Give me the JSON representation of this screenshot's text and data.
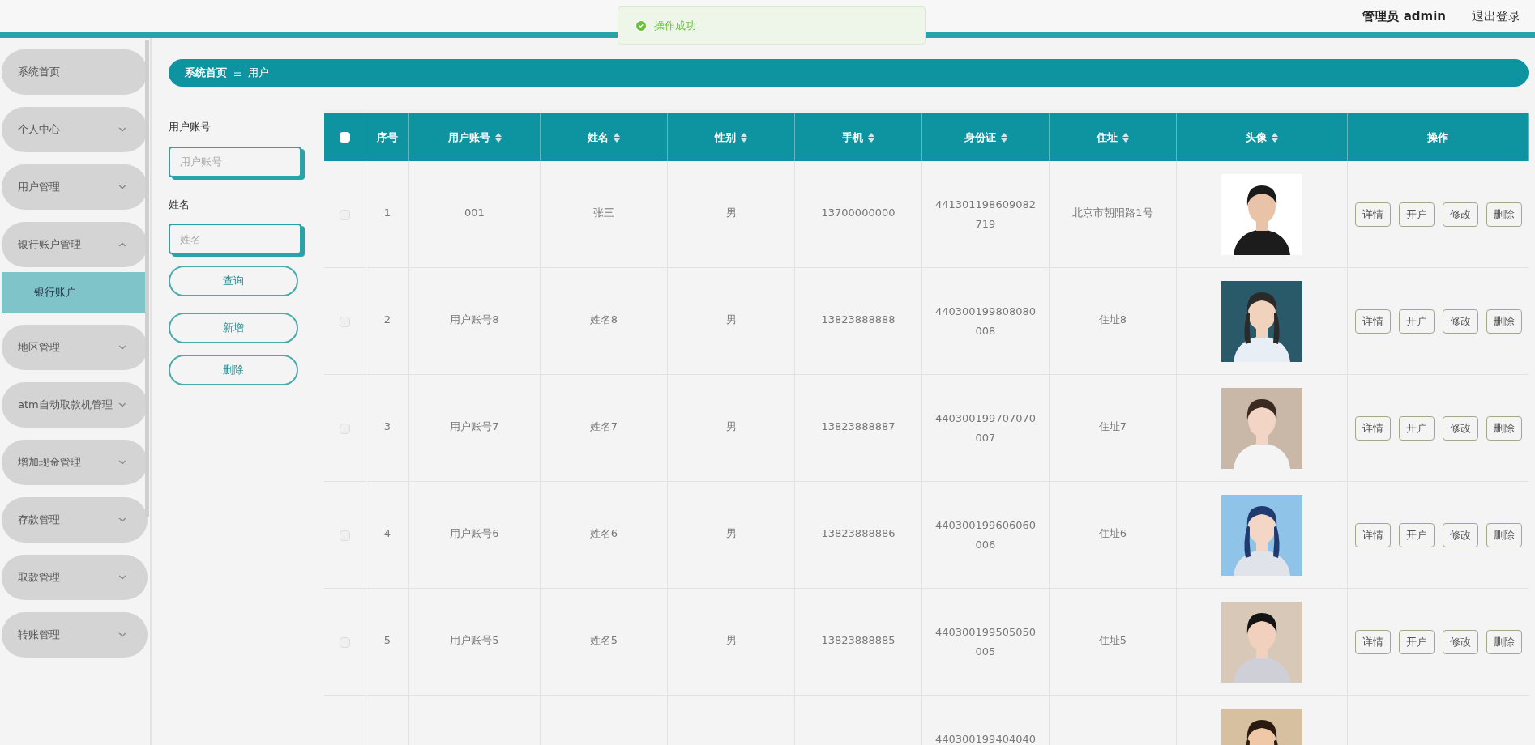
{
  "header": {
    "user_label": "管理员 admin",
    "logout": "退出登录"
  },
  "toast": {
    "text": "操作成功",
    "kind": "success"
  },
  "sidebar": {
    "items": [
      {
        "label": "系统首页",
        "kind": "link"
      },
      {
        "label": "个人中心",
        "kind": "menu",
        "expanded": false
      },
      {
        "label": "用户管理",
        "kind": "menu",
        "expanded": false
      },
      {
        "label": "银行账户管理",
        "kind": "menu",
        "expanded": true,
        "children": [
          {
            "label": "银行账户",
            "selected": true
          }
        ]
      },
      {
        "label": "地区管理",
        "kind": "menu",
        "expanded": false
      },
      {
        "label": "atm自动取款机管理",
        "kind": "menu",
        "expanded": false
      },
      {
        "label": "增加现金管理",
        "kind": "menu",
        "expanded": false
      },
      {
        "label": "存款管理",
        "kind": "menu",
        "expanded": false
      },
      {
        "label": "取款管理",
        "kind": "menu",
        "expanded": false
      },
      {
        "label": "转账管理",
        "kind": "menu",
        "expanded": false
      }
    ]
  },
  "breadcrumb": [
    "系统首页",
    "用户"
  ],
  "filters": [
    {
      "label": "用户账号",
      "placeholder": "用户账号"
    },
    {
      "label": "姓名",
      "placeholder": "姓名"
    }
  ],
  "filter_buttons": [
    "查询",
    "新增",
    "删除"
  ],
  "table": {
    "select_all": {
      "checked": false
    },
    "columns": [
      {
        "label": "序号",
        "sortable": false
      },
      {
        "label": "用户账号",
        "sortable": true
      },
      {
        "label": "姓名",
        "sortable": true
      },
      {
        "label": "性别",
        "sortable": true
      },
      {
        "label": "手机",
        "sortable": true
      },
      {
        "label": "身份证",
        "sortable": true
      },
      {
        "label": "住址",
        "sortable": true
      },
      {
        "label": "头像",
        "sortable": true
      },
      {
        "label": "操作",
        "sortable": false
      }
    ],
    "rows": [
      {
        "checked": false,
        "cells": [
          "1",
          "001",
          "张三",
          "男",
          "13700000000",
          "441301198609082719",
          "北京市朝阳路1号"
        ],
        "actions": [
          "详情",
          "开户",
          "修改",
          "删除"
        ]
      },
      {
        "checked": false,
        "cells": [
          "2",
          "用户账号8",
          "姓名8",
          "男",
          "13823888888",
          "440300199808080008",
          "住址8"
        ],
        "actions": [
          "详情",
          "开户",
          "修改",
          "删除"
        ]
      },
      {
        "checked": false,
        "cells": [
          "3",
          "用户账号7",
          "姓名7",
          "男",
          "13823888887",
          "440300199707070007",
          "住址7"
        ],
        "actions": [
          "详情",
          "开户",
          "修改",
          "删除"
        ]
      },
      {
        "checked": false,
        "cells": [
          "4",
          "用户账号6",
          "姓名6",
          "男",
          "13823888886",
          "440300199606060006",
          "住址6"
        ],
        "actions": [
          "详情",
          "开户",
          "修改",
          "删除"
        ]
      },
      {
        "checked": false,
        "cells": [
          "5",
          "用户账号5",
          "姓名5",
          "男",
          "13823888885",
          "440300199505050005",
          "住址5"
        ],
        "actions": [
          "详情",
          "开户",
          "修改",
          "删除"
        ]
      },
      {
        "cells": [
          "",
          "",
          "",
          "",
          "",
          "440300199404040",
          ""
        ]
      }
    ]
  }
}
